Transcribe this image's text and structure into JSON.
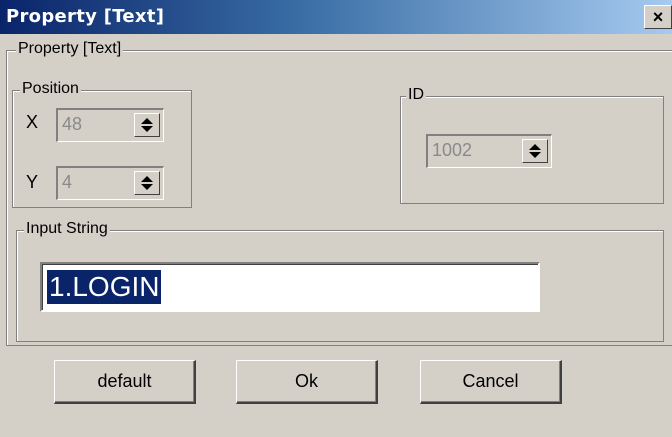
{
  "window": {
    "title": "Property [Text]",
    "close_glyph": "×",
    "close_icon": "close-icon"
  },
  "outer_group": {
    "legend": "Property [Text]"
  },
  "position_group": {
    "legend": "Position",
    "x_label": "X",
    "x_value": "48",
    "y_label": "Y",
    "y_value": "4"
  },
  "id_group": {
    "legend": "ID",
    "value": "1002"
  },
  "input_group": {
    "legend": "Input String",
    "value": "1.LOGIN"
  },
  "buttons": {
    "default": "default",
    "ok": "Ok",
    "cancel": "Cancel"
  },
  "colors": {
    "title_start": "#0a246a",
    "title_end": "#a6caf0",
    "face": "#d4d0c8",
    "selection": "#0a246a"
  }
}
